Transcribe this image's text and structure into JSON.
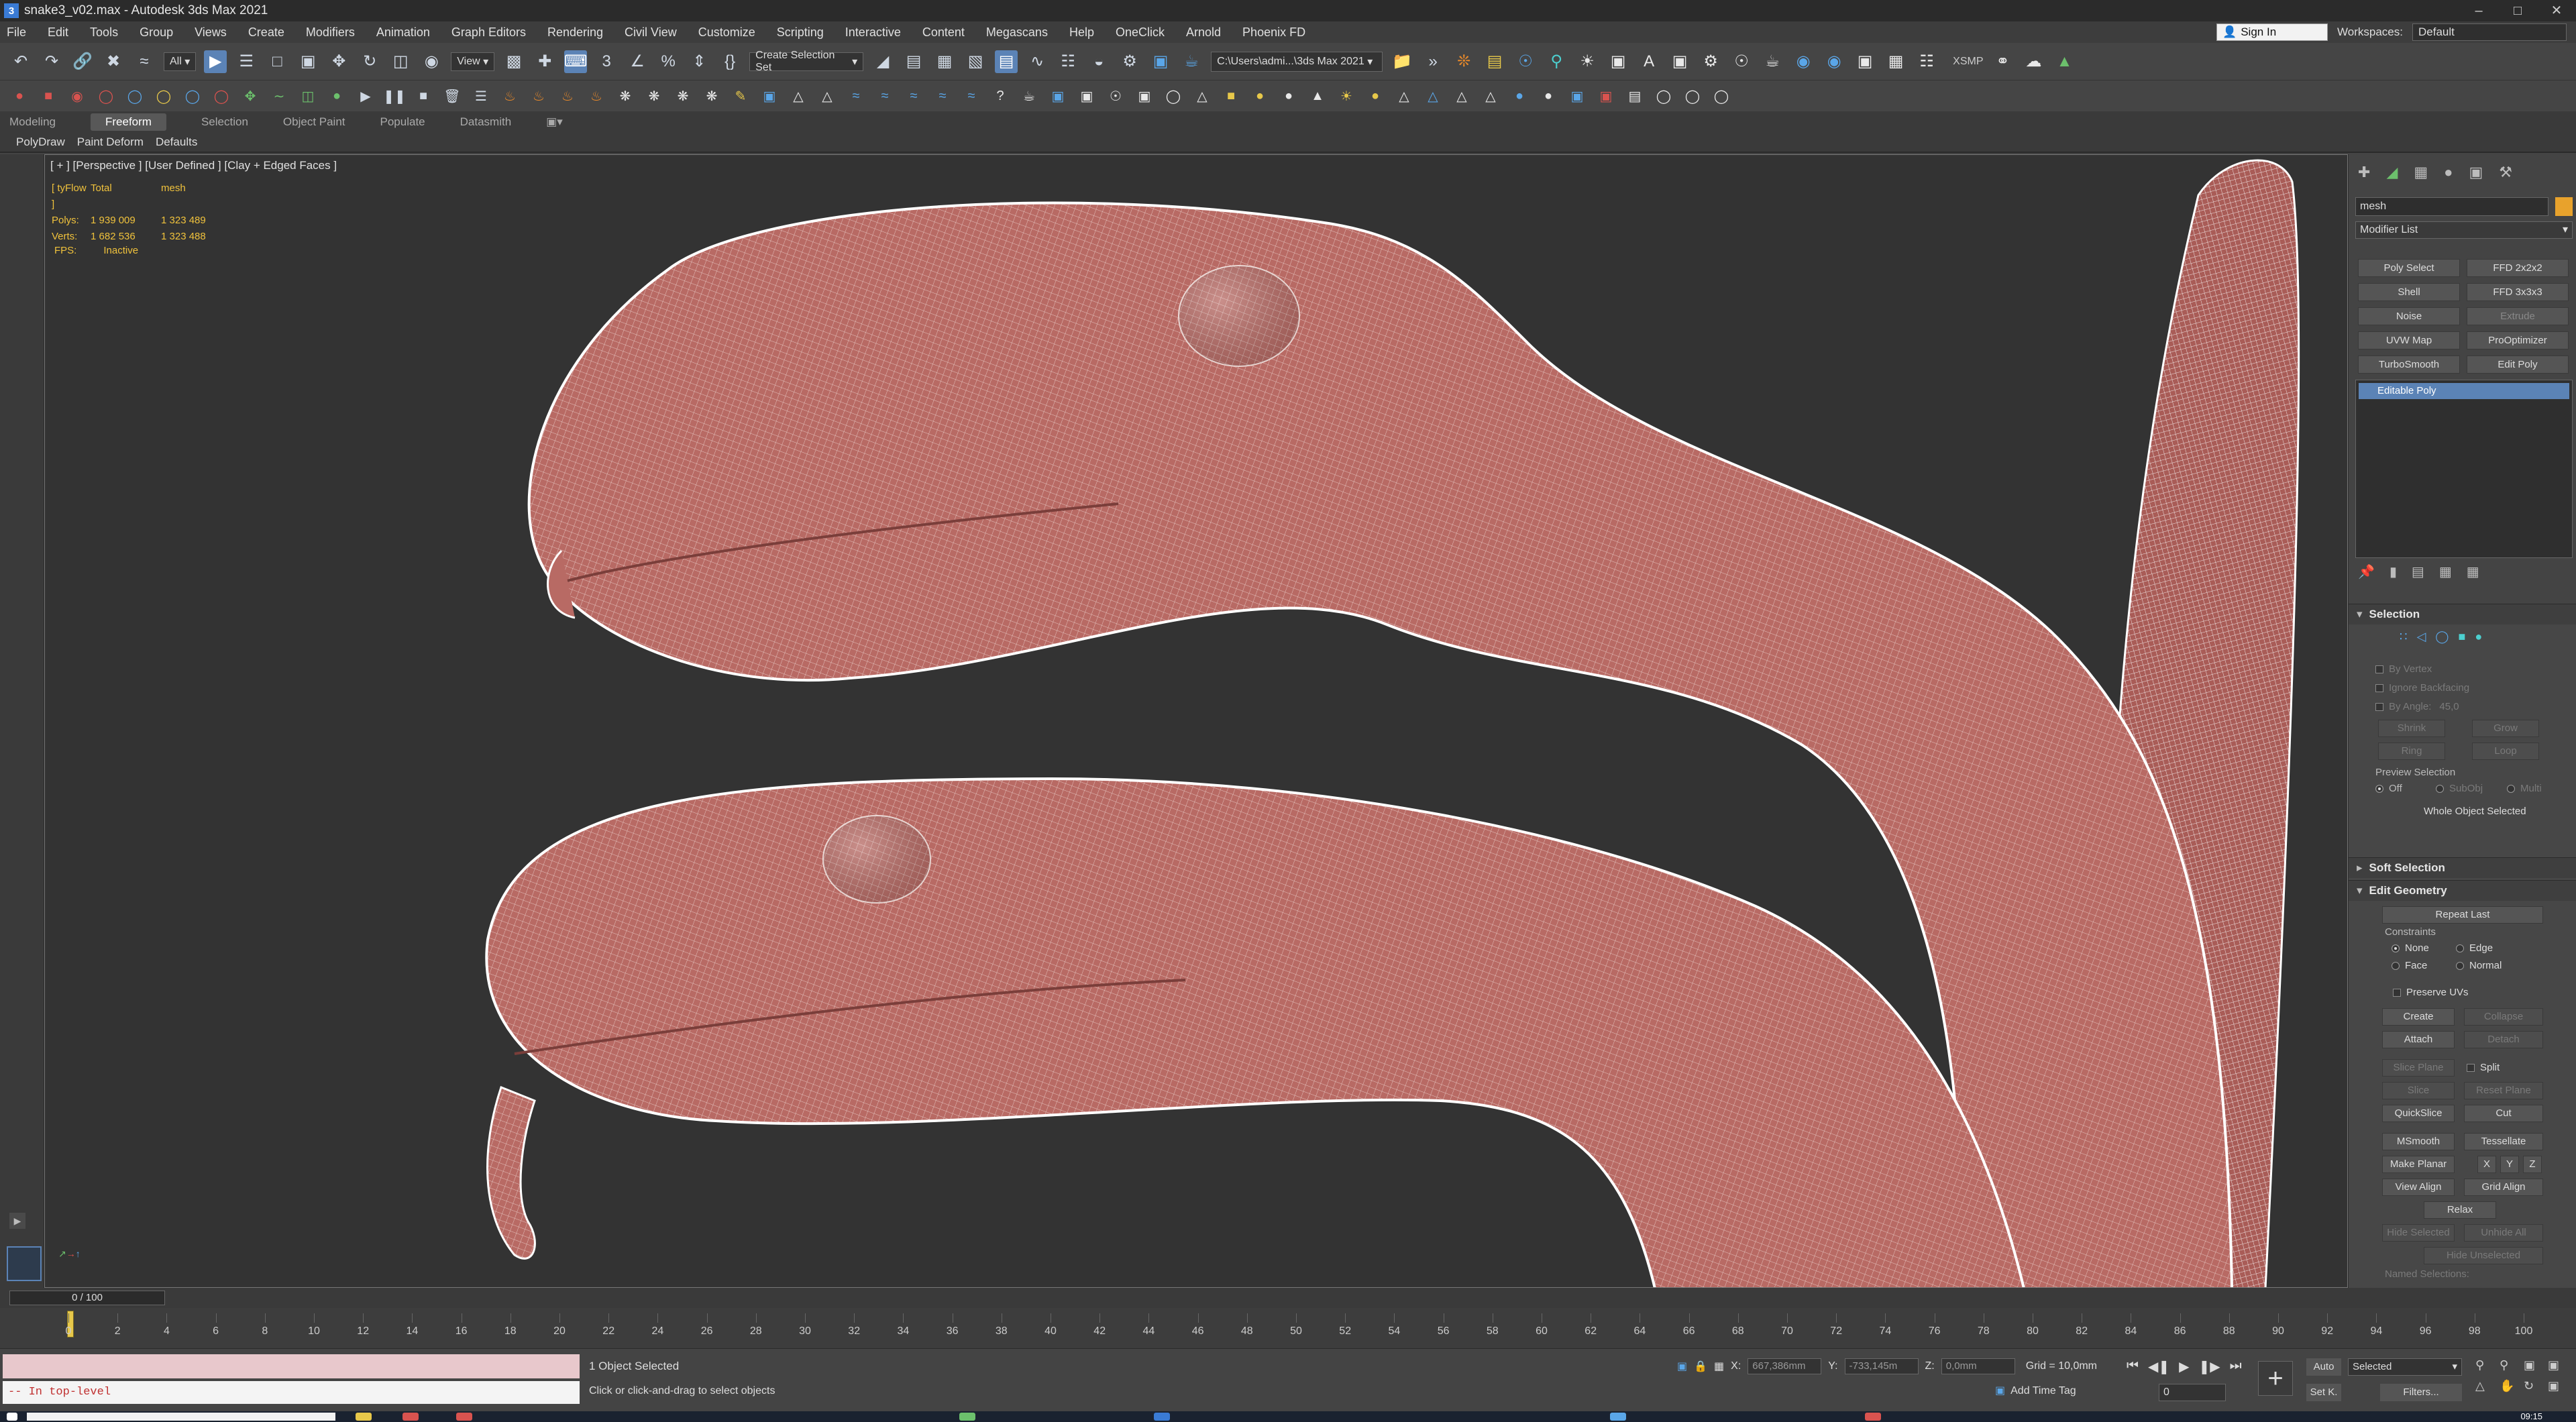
{
  "window": {
    "title": "snake3_v02.max - Autodesk 3ds Max 2021",
    "app_icon": "3",
    "controls": [
      "–",
      "□",
      "✕"
    ]
  },
  "menu": {
    "items": [
      "File",
      "Edit",
      "Tools",
      "Group",
      "Views",
      "Create",
      "Modifiers",
      "Animation",
      "Graph Editors",
      "Rendering",
      "Civil View",
      "Customize",
      "Scripting",
      "Interactive",
      "Content",
      "Megascans",
      "Help",
      "OneClick",
      "Arnold",
      "Phoenix FD"
    ],
    "sign_in": "Sign In",
    "workspaces_label": "Workspaces:",
    "workspace_value": "Default"
  },
  "toolbar": {
    "filter_value": "All",
    "view_value": "View",
    "selection_set_placeholder": "Create Selection Set",
    "project_path": "C:\\Users\\admi...\\3ds Max 2021",
    "xsmp_label": "XSMP"
  },
  "ribbon": {
    "tabs": [
      "Modeling",
      "Freeform",
      "Selection",
      "Object Paint",
      "Populate",
      "Datasmith"
    ],
    "active_tab": "Freeform",
    "sub_tabs": [
      "PolyDraw",
      "Paint Deform",
      "Defaults"
    ]
  },
  "viewport": {
    "label": "[ + ] [Perspective ] [User Defined ] [Clay + Edged Faces ]",
    "stats": {
      "header": [
        "[ tyFlow ]",
        "Total",
        "mesh"
      ],
      "polys": [
        "Polys:",
        "1 939 009",
        "1 323 489"
      ],
      "verts": [
        "Verts:",
        "1 682 536",
        "1 323 488"
      ]
    },
    "fps_label": "FPS:",
    "fps_value": "Inactive",
    "mesh_color": "#b86a64",
    "wire_color": "#ffffff"
  },
  "command_panel": {
    "object_name": "mesh",
    "object_color": "#e8a22c",
    "modifier_list": "Modifier List",
    "modifier_buttons": [
      "Poly Select",
      "FFD 2x2x2",
      "Shell",
      "FFD 3x3x3",
      "Noise",
      "Extrude",
      "UVW Map",
      "ProOptimizer",
      "TurboSmooth",
      "Edit Poly"
    ],
    "stack_item": "Editable Poly",
    "selection": {
      "title": "Selection",
      "by_vertex": "By Vertex",
      "ignore_backfacing": "Ignore Backfacing",
      "by_angle": "By Angle:",
      "angle_value": "45,0",
      "shrink": "Shrink",
      "grow": "Grow",
      "ring": "Ring",
      "loop": "Loop",
      "preview_selection": "Preview Selection",
      "preview_options": [
        "Off",
        "SubObj",
        "Multi"
      ],
      "whole_object": "Whole Object Selected"
    },
    "soft_selection": {
      "title": "Soft Selection"
    },
    "edit_geometry": {
      "title": "Edit Geometry",
      "repeat_last": "Repeat Last",
      "constraints": "Constraints",
      "constraint_options": [
        "None",
        "Edge",
        "Face",
        "Normal"
      ],
      "preserve_uvs": "Preserve UVs",
      "create": "Create",
      "collapse": "Collapse",
      "attach": "Attach",
      "detach": "Detach",
      "slice_plane": "Slice Plane",
      "split": "Split",
      "slice": "Slice",
      "reset_plane": "Reset Plane",
      "quickslice": "QuickSlice",
      "cut": "Cut",
      "msmooth": "MSmooth",
      "tessellate": "Tessellate",
      "make_planar": "Make Planar",
      "x": "X",
      "y": "Y",
      "z": "Z",
      "view_align": "View Align",
      "grid_align": "Grid Align",
      "relax": "Relax",
      "hide_selected": "Hide Selected",
      "unhide_all": "Unhide All",
      "hide_unselected": "Hide Unselected",
      "named_selections": "Named Selections:"
    }
  },
  "timeline": {
    "slider_text": "0 / 100",
    "current_frame": 0,
    "ticks": [
      "0",
      "2",
      "4",
      "6",
      "8",
      "10",
      "12",
      "14",
      "16",
      "18",
      "20",
      "22",
      "24",
      "26",
      "28",
      "30",
      "32",
      "34",
      "36",
      "38",
      "40",
      "42",
      "44",
      "46",
      "48",
      "50",
      "52",
      "54",
      "56",
      "58",
      "60",
      "62",
      "64",
      "66",
      "68",
      "70",
      "72",
      "74",
      "76",
      "78",
      "80",
      "82",
      "84",
      "86",
      "88",
      "90",
      "92",
      "94",
      "96",
      "98",
      "100"
    ]
  },
  "status": {
    "listener_prompt": "-- In top-level",
    "objects_selected": "1 Object Selected",
    "hint": "Click or click-and-drag to select objects",
    "x_label": "X:",
    "x_value": "667,386mm",
    "y_label": "Y:",
    "y_value": "-733,145m",
    "z_label": "Z:",
    "z_value": "0,0mm",
    "grid": "Grid = 10,0mm",
    "add_time_tag": "Add Time Tag",
    "frame_value": "0",
    "auto": "Auto",
    "set_key": "Set K.",
    "selected_value": "Selected",
    "filters": "Filters...",
    "clock": "09:15"
  }
}
